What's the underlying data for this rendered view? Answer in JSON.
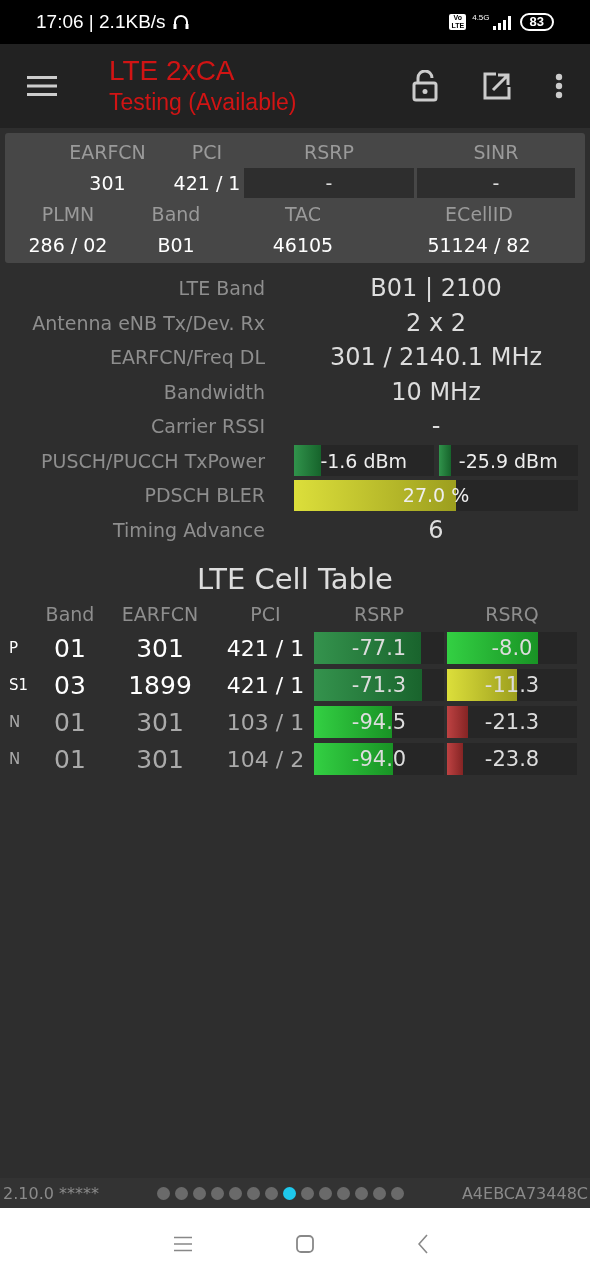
{
  "status_bar": {
    "time": "17:06 | 2.1KB/s",
    "volte": [
      "Vo",
      "LTE"
    ],
    "network": "4.5G",
    "battery": "83"
  },
  "app_bar": {
    "title": "LTE 2xCA",
    "subtitle": "Testing (Available)"
  },
  "summary": {
    "rows": [
      [
        {
          "label": "EARFCN",
          "value": "301",
          "kind": "plain"
        },
        {
          "label": "PCI",
          "value": "421 / 1",
          "kind": "plain"
        },
        {
          "label": "RSRP",
          "value": "-",
          "kind": "box"
        },
        {
          "label": "SINR",
          "value": "-",
          "kind": "box"
        }
      ],
      [
        {
          "label": "PLMN",
          "value": "286 / 02",
          "kind": "plain"
        },
        {
          "label": "Band",
          "value": "B01",
          "kind": "plain"
        },
        {
          "label": "TAC",
          "value": "46105",
          "kind": "plain"
        },
        {
          "label": "ECellID",
          "value": "51124 / 82",
          "kind": "plain"
        }
      ]
    ]
  },
  "details": [
    {
      "label": "LTE Band",
      "kind": "text",
      "value": "B01 | 2100"
    },
    {
      "label": "Antenna eNB Tx/Dev. Rx",
      "kind": "text",
      "value": "2 x 2"
    },
    {
      "label": "EARFCN/Freq DL",
      "kind": "text",
      "value": "301 / 2140.1 MHz"
    },
    {
      "label": "Bandwidth",
      "kind": "text",
      "value": "10 MHz"
    },
    {
      "label": "Carrier RSSI",
      "kind": "text",
      "value": "-"
    },
    {
      "label": "PUSCH/PUCCH TxPower",
      "kind": "bars",
      "bars": [
        {
          "text": "-1.6 dBm",
          "level": 0.19,
          "color": "#1f8a3c"
        },
        {
          "text": "-25.9 dBm",
          "level": 0.09,
          "color": "#1f8a3c"
        }
      ]
    },
    {
      "label": "PDSCH BLER",
      "kind": "bars",
      "bars": [
        {
          "text": "27.0 %",
          "level": 0.57,
          "color": "#d9dc2a"
        }
      ]
    },
    {
      "label": "Timing Advance",
      "kind": "text",
      "value": "6"
    }
  ],
  "cell_table": {
    "title": "LTE Cell Table",
    "columns": [
      "Band",
      "EARFCN",
      "PCI",
      "RSRP",
      "RSRQ"
    ],
    "rows": [
      {
        "type": "P",
        "serving": true,
        "band": "01",
        "earfcn": "301",
        "pci": "421 / 1",
        "rsrp": {
          "text": "-77.1",
          "level": 0.82,
          "color": "#238a3e"
        },
        "rsrq": {
          "text": "-8.0",
          "level": 0.7,
          "color": "#22cc33"
        }
      },
      {
        "type": "S1",
        "serving": true,
        "band": "03",
        "earfcn": "1899",
        "pci": "421 / 1",
        "rsrp": {
          "text": "-71.3",
          "level": 0.83,
          "color": "#238a3e"
        },
        "rsrq": {
          "text": "-11.3",
          "level": 0.54,
          "color": "#d9dc2a"
        }
      },
      {
        "type": "N",
        "serving": false,
        "band": "01",
        "earfcn": "301",
        "pci": "103 / 1",
        "rsrp": {
          "text": "-94.5",
          "level": 0.6,
          "color": "#22cc33"
        },
        "rsrq": {
          "text": "-21.3",
          "level": 0.16,
          "color": "#b83232"
        }
      },
      {
        "type": "N",
        "serving": false,
        "band": "01",
        "earfcn": "301",
        "pci": "104 / 2",
        "rsrp": {
          "text": "-94.0",
          "level": 0.61,
          "color": "#22cc33"
        },
        "rsrq": {
          "text": "-23.8",
          "level": 0.12,
          "color": "#b83232"
        }
      }
    ]
  },
  "footer": {
    "version": "2.10.0 *****",
    "pages": [
      {
        "selected": false
      },
      {
        "selected": false
      },
      {
        "selected": false
      },
      {
        "selected": false
      },
      {
        "selected": false
      },
      {
        "selected": false
      },
      {
        "selected": false
      },
      {
        "selected": true
      },
      {
        "selected": false
      },
      {
        "selected": false
      },
      {
        "selected": false
      },
      {
        "selected": false
      },
      {
        "selected": false
      },
      {
        "selected": false
      }
    ],
    "device_id": "A4EBCA73448C"
  }
}
